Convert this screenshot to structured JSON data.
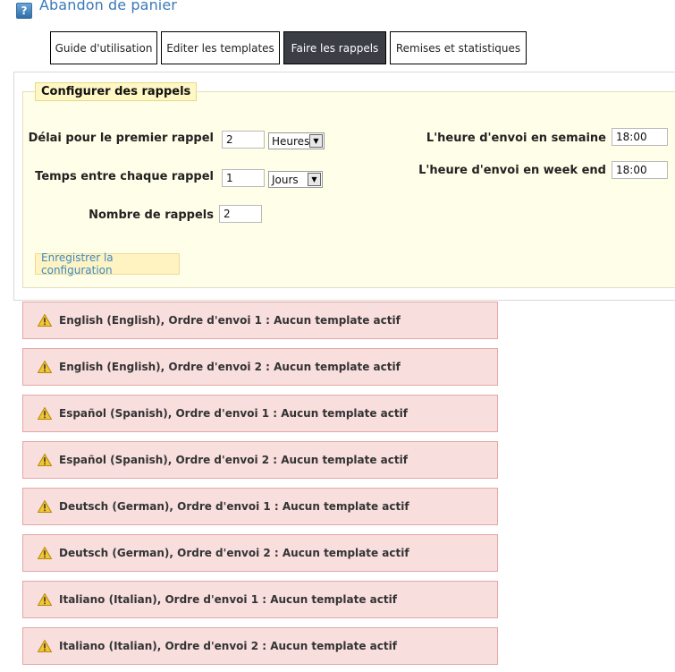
{
  "header": {
    "title": "Abandon de panier",
    "help_icon_glyph": "?"
  },
  "tabs": [
    {
      "label": "Guide d'utilisation",
      "active": false
    },
    {
      "label": "Editer les templates",
      "active": false
    },
    {
      "label": "Faire les rappels",
      "active": true
    },
    {
      "label": "Remises et statistiques",
      "active": false
    }
  ],
  "config": {
    "legend": "Configurer des rappels",
    "first_delay_label": "Délai pour le premier rappel",
    "first_delay_value": "2",
    "first_delay_unit": "Heures",
    "between_label": "Temps entre chaque rappel",
    "between_value": "1",
    "between_unit": "Jours",
    "count_label": "Nombre de rappels",
    "count_value": "2",
    "weekday_label": "L'heure d'envoi en semaine",
    "weekday_value": "18:00",
    "weekend_label": "L'heure d'envoi en week end",
    "weekend_value": "18:00",
    "save_label": "Enregistrer la configuration"
  },
  "alerts": [
    "English (English), Ordre d'envoi 1 : Aucun template actif",
    "English (English), Ordre d'envoi 2 : Aucun template actif",
    "Español (Spanish), Ordre d'envoi 1 : Aucun template actif",
    "Español (Spanish), Ordre d'envoi 2 : Aucun template actif",
    "Deutsch (German), Ordre d'envoi 1 : Aucun template actif",
    "Deutsch (German), Ordre d'envoi 2 : Aucun template actif",
    "Italiano (Italian), Ordre d'envoi 1 : Aucun template actif",
    "Italiano (Italian), Ordre d'envoi 2 : Aucun template actif"
  ],
  "colors": {
    "title": "#3c7ab8",
    "active_tab_bg": "#3b3e45",
    "panel_bg": "#fffee8",
    "alert_bg": "#f8dedd",
    "alert_border": "#e4a7a5",
    "link": "#3b8ac9"
  },
  "icons": {
    "help": "help-book-icon",
    "warning": "warning-triangle-icon"
  }
}
